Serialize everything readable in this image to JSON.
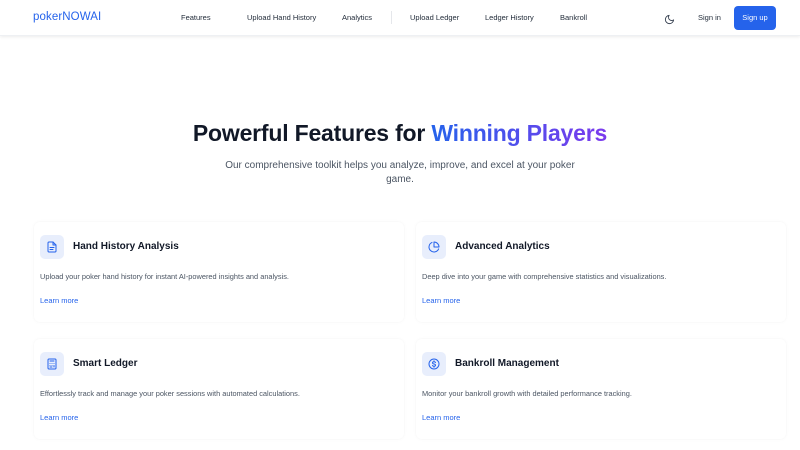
{
  "nav": {
    "logo": "pokerNOWAI",
    "links": [
      "Features",
      "Upload Hand History",
      "Analytics",
      "Upload Ledger",
      "Ledger History",
      "Bankroll"
    ],
    "theme_toggle_icon": "moon-icon",
    "signin": "Sign in",
    "signup": "Sign up"
  },
  "hero": {
    "title_prefix": "Powerful Features for",
    "title_highlight": "Winning Players",
    "subtitle": "Our comprehensive toolkit helps you analyze, improve, and excel at your poker game."
  },
  "features": [
    {
      "icon": "document-icon",
      "title": "Hand History Analysis",
      "description": "Upload your poker hand history for instant AI-powered insights and analysis.",
      "link": "Learn more"
    },
    {
      "icon": "pie-chart-icon",
      "title": "Advanced Analytics",
      "description": "Deep dive into your game with comprehensive statistics and visualizations.",
      "link": "Learn more"
    },
    {
      "icon": "calculator-icon",
      "title": "Smart Ledger",
      "description": "Effortlessly track and manage your poker sessions with automated calculations.",
      "link": "Learn more"
    },
    {
      "icon": "dollar-circle-icon",
      "title": "Bankroll Management",
      "description": "Monitor your bankroll growth with detailed performance tracking.",
      "link": "Learn more"
    }
  ],
  "colors": {
    "brand": "#2563eb",
    "gradient_end": "#7c3aed",
    "icon_bg": "#e8eefc"
  }
}
